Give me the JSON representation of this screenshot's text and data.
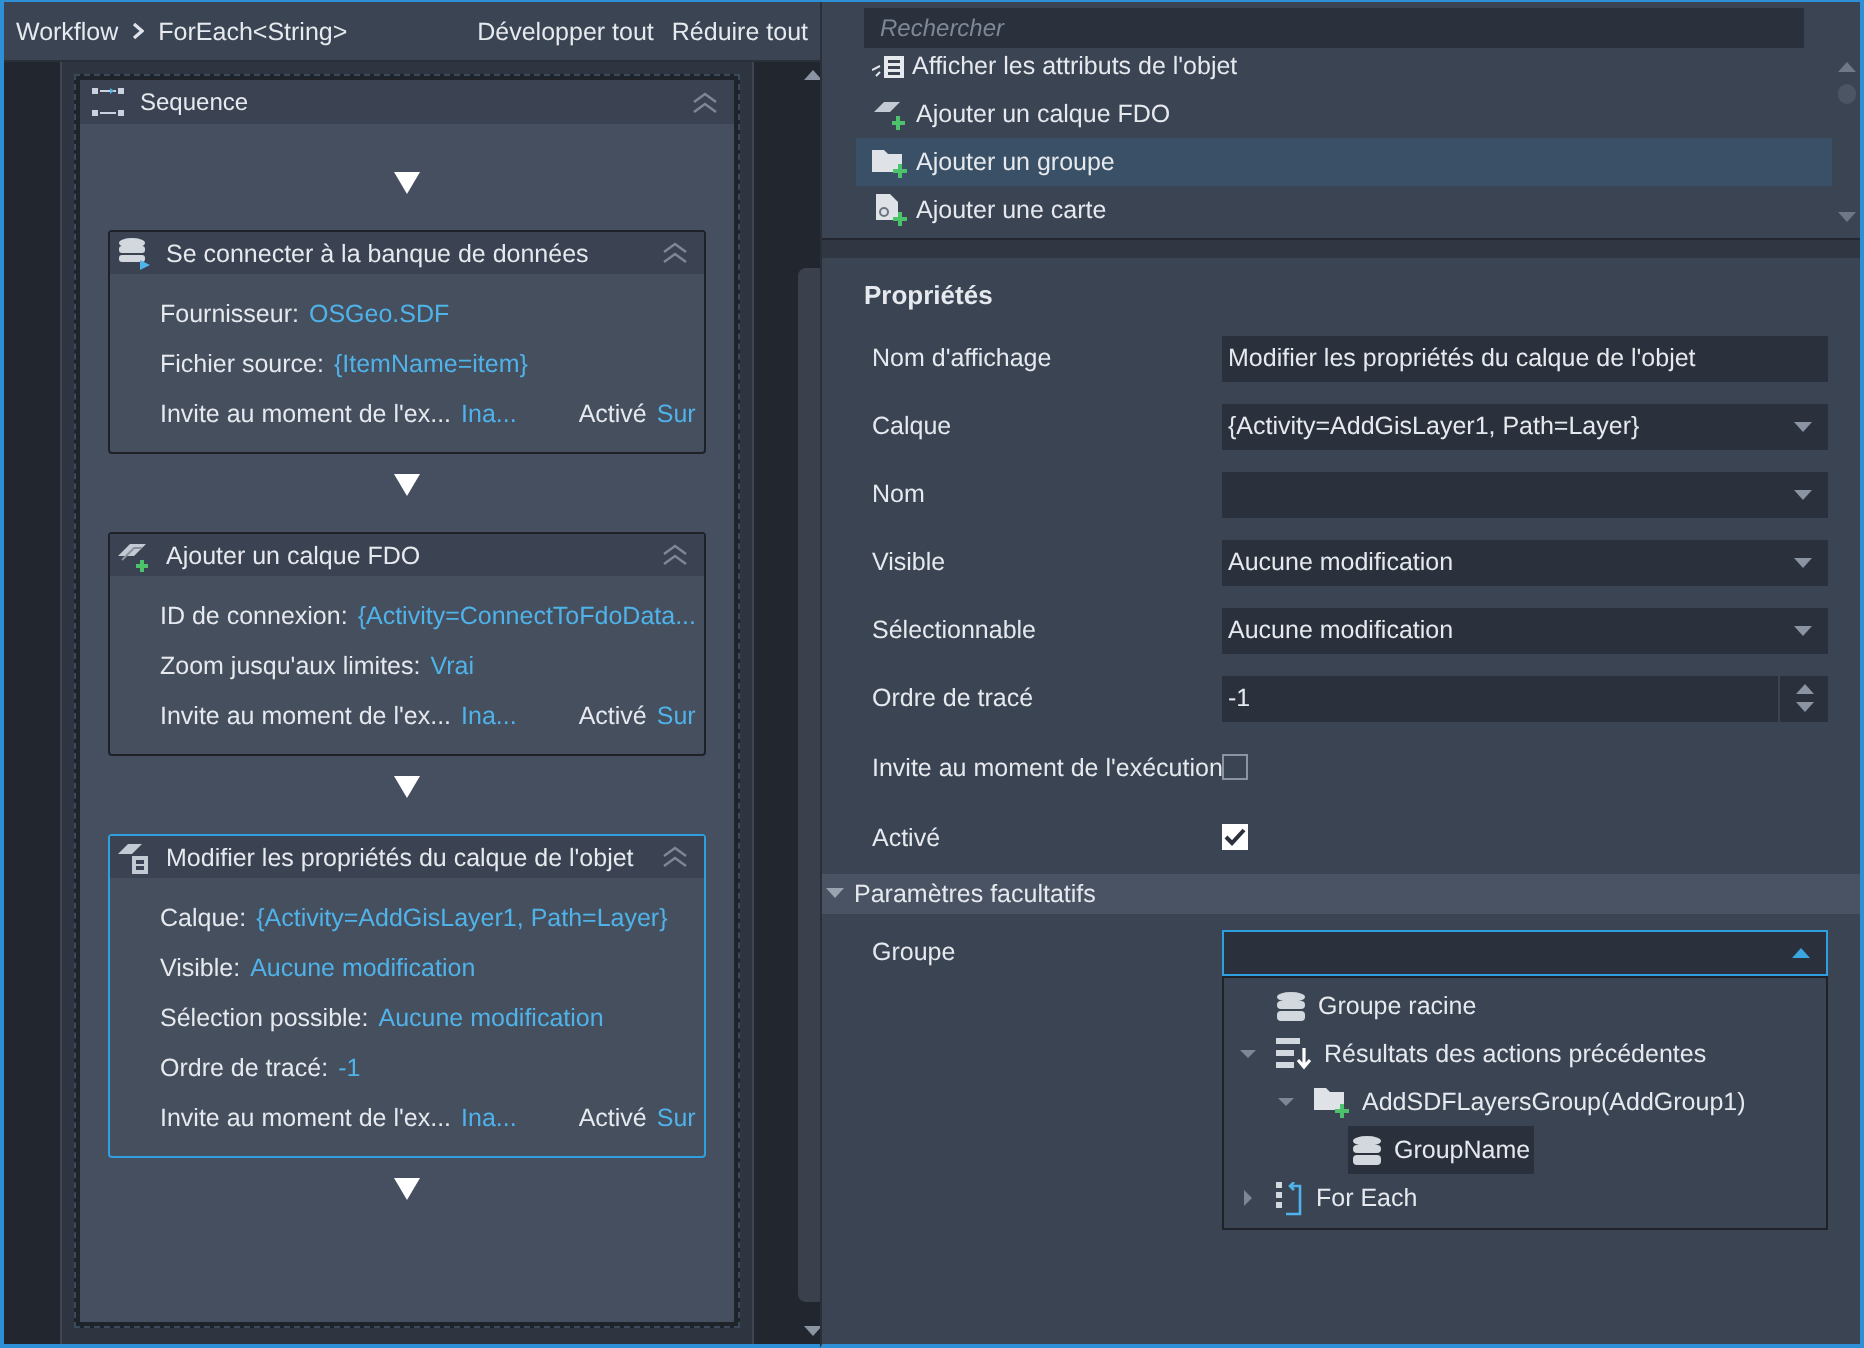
{
  "breadcrumb": {
    "items": [
      "Workflow",
      "ForEach<String>"
    ],
    "actions": [
      "Développer tout",
      "Réduire tout"
    ]
  },
  "sequence": {
    "title": "Sequence",
    "activities": [
      {
        "kind": "database",
        "title": "Se connecter à la banque de données",
        "selected": false,
        "fields": [
          {
            "label": "Fournisseur:",
            "value": "OSGeo.SDF"
          },
          {
            "label": "Fichier source:",
            "value": "{ItemName=item}"
          }
        ],
        "footer": [
          {
            "label": "Invite au moment de l'ex...",
            "value": "Ina..."
          },
          {
            "label": "Activé",
            "value": "Sur"
          }
        ]
      },
      {
        "kind": "layer",
        "title": "Ajouter un calque FDO",
        "selected": false,
        "fields": [
          {
            "label": "ID de connexion:",
            "value": "{Activity=ConnectToFdoData..."
          },
          {
            "label": "Zoom jusqu'aux limites:",
            "value": "Vrai"
          }
        ],
        "footer": [
          {
            "label": "Invite au moment de l'ex...",
            "value": "Ina..."
          },
          {
            "label": "Activé",
            "value": "Sur"
          }
        ]
      },
      {
        "kind": "layer-props",
        "title": "Modifier les propriétés du calque de l'objet",
        "selected": true,
        "fields": [
          {
            "label": "Calque:",
            "value": "{Activity=AddGisLayer1, Path=Layer}"
          },
          {
            "label": "Visible:",
            "value": "Aucune modification"
          },
          {
            "label": "Sélection possible:",
            "value": "Aucune modification"
          },
          {
            "label": "Ordre de tracé:",
            "value": "-1"
          }
        ],
        "footer": [
          {
            "label": "Invite au moment de l'ex...",
            "value": "Ina..."
          },
          {
            "label": "Activé",
            "value": "Sur"
          }
        ]
      }
    ]
  },
  "toolbox": {
    "search": {
      "placeholder": "Rechercher"
    },
    "items": [
      {
        "kind": "attributes",
        "label": "Afficher les attributs de l'objet",
        "selected": false
      },
      {
        "kind": "layer",
        "label": "Ajouter un calque FDO",
        "selected": false
      },
      {
        "kind": "folder-add",
        "label": "Ajouter un groupe",
        "selected": true
      },
      {
        "kind": "map",
        "label": "Ajouter une carte",
        "selected": false
      }
    ]
  },
  "properties": {
    "title": "Propriétés",
    "rows": [
      {
        "kind": "text",
        "label": "Nom d'affichage",
        "value": "Modifier les propriétés du calque de l'objet"
      },
      {
        "kind": "dropdown",
        "label": "Calque",
        "value": "{Activity=AddGisLayer1, Path=Layer}"
      },
      {
        "kind": "dropdown",
        "label": "Nom"
      },
      {
        "kind": "dropdown",
        "label": "Visible",
        "value": "Aucune modification"
      },
      {
        "kind": "dropdown",
        "label": "Sélectionnable",
        "value": "Aucune modification"
      },
      {
        "kind": "spinner",
        "label": "Ordre de tracé",
        "value": "-1"
      },
      {
        "kind": "checkbox",
        "label": "Invite au moment de l'exécution",
        "checked": false
      },
      {
        "kind": "checkbox",
        "label": "Activé",
        "checked": true
      }
    ]
  },
  "optional": {
    "title": "Paramètres facultatifs",
    "expanded": true,
    "group": {
      "label": "Groupe",
      "open": true,
      "options": [
        {
          "kind": "database",
          "label": "Groupe racine",
          "selected": false
        },
        {
          "kind": "results",
          "label": "Résultats des actions précédentes",
          "selected": false,
          "expanded": true,
          "children": [
            {
              "kind": "folder-add",
              "label": "AddSDFLayersGroup(AddGroup1)",
              "selected": false,
              "expanded": true,
              "children": [
                {
                  "kind": "database",
                  "label": "GroupName",
                  "selected": true
                }
              ]
            }
          ]
        },
        {
          "kind": "loop",
          "label": "For Each",
          "selected": false,
          "expanded": false
        }
      ]
    }
  }
}
